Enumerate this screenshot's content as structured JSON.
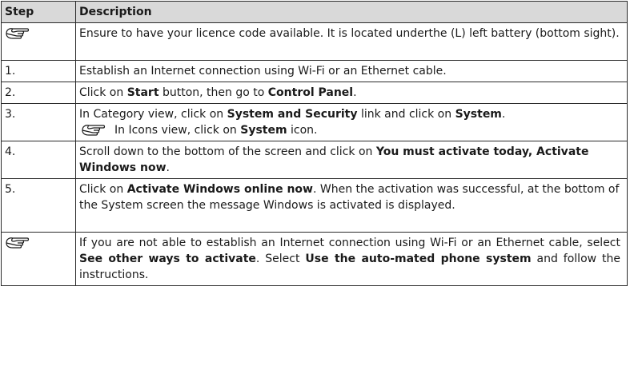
{
  "header": {
    "step": "Step",
    "description": "Description"
  },
  "rows": [
    {
      "step_icon": "pointing-hand-icon",
      "text": "Ensure to have your licence code available. It is located underthe (L) left battery (bottom sight)."
    },
    {
      "step": "1.",
      "text": "Establish an Internet connection using Wi-Fi or an Ethernet cable."
    },
    {
      "step": "2.",
      "parts": [
        "Click on ",
        "Start",
        " button, then go to ",
        "Control Panel",
        "."
      ]
    },
    {
      "step": "3.",
      "parts": [
        "In Category view, click on ",
        "System and Security",
        " link and click on ",
        "System",
        "."
      ],
      "note_icon": "pointing-hand-icon",
      "note_parts": [
        "In Icons view, click on ",
        "System",
        " icon."
      ]
    },
    {
      "step": "4.",
      "parts": [
        "Scroll down to the bottom of the screen and click on ",
        "You must activate today, Activate Windows now",
        "."
      ]
    },
    {
      "step": "5.",
      "parts": [
        "Click on ",
        "Activate Windows online now",
        ". When the activation was successful, at the bottom of the System screen the message Windows is activated is displayed."
      ]
    },
    {
      "step_icon": "pointing-hand-icon",
      "parts": [
        "If you are not able to establish an Internet connection using Wi-Fi or an Ethernet cable, select ",
        "See other ways to activate",
        ". Select ",
        "Use the auto-mated phone system",
        " and follow the instructions."
      ]
    }
  ]
}
